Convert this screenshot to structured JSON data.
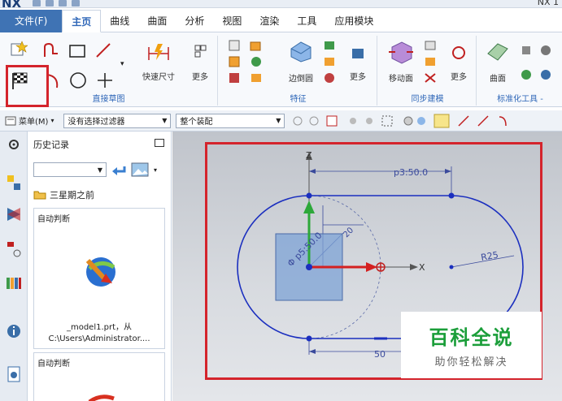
{
  "app": {
    "logo": "NX",
    "title": "NX 1"
  },
  "menu": {
    "tabs": [
      "文件(F)",
      "主页",
      "曲线",
      "曲面",
      "分析",
      "视图",
      "渲染",
      "工具",
      "应用模块"
    ],
    "active": "主页"
  },
  "ribbon": {
    "groups": {
      "direct_sketch": {
        "label": "直接草图",
        "quick_dim": "快速尺寸",
        "more": "更多"
      },
      "feature": {
        "label": "特征",
        "edge_blend": "边倒圆",
        "more": "更多"
      },
      "sync": {
        "label": "同步建模",
        "move_face": "移动面",
        "more": "更多"
      },
      "surface": {
        "label": "标准化工具 -",
        "surface": "曲面"
      }
    }
  },
  "command_bar": {
    "menu_label": "菜单(M)",
    "filter": "没有选择过滤器",
    "assembly": "整个装配"
  },
  "history": {
    "title": "历史记录",
    "folder": "三星期之前",
    "items": [
      {
        "label": "自动判断",
        "file": "_model1.prt，从",
        "path": "C:\\Users\\Administrator...."
      },
      {
        "label": "自动判断"
      }
    ]
  },
  "sketch": {
    "dimensions": [
      "p3:50.0",
      "R25",
      "Φ p5:50.0",
      "20",
      "50"
    ],
    "axis_z": "Z",
    "axis_x": "X"
  },
  "watermark": {
    "title": "百科全说",
    "subtitle": "助你轻松解决"
  },
  "colors": {
    "accent": "#2f67b8",
    "highlight": "#d4242c",
    "sketch": "#1b2fbf",
    "watermark": "#1b9e3a"
  }
}
